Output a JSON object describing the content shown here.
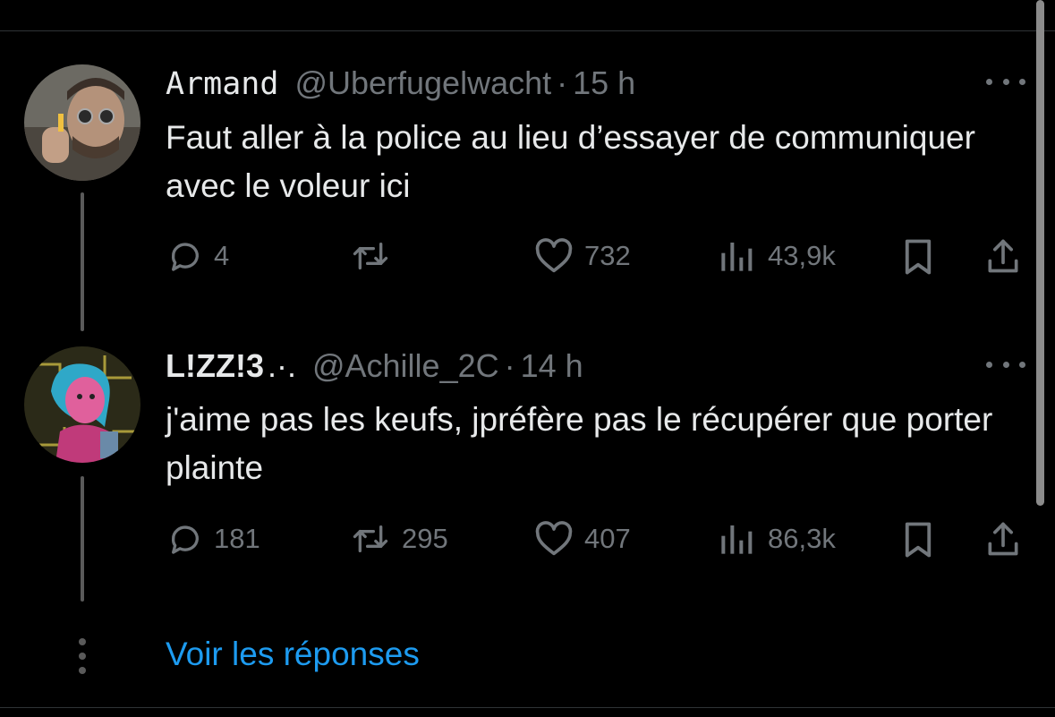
{
  "thread": {
    "tweets": [
      {
        "display_name": "Armand",
        "handle": "@Uberfugelwacht",
        "separator": "·",
        "time": "15 h",
        "text": "Faut aller à la police au lieu d’essayer de communiquer avec le voleur ici",
        "replies": "4",
        "retweets": "",
        "likes": "732",
        "views": "43,9k"
      },
      {
        "display_name": "L!ZZ!3",
        "display_name_suffix": ".·.",
        "handle": "@Achille_2C",
        "separator": "·",
        "time": "14 h",
        "text": "j'aime pas les keufs, jpréfère pas le récupérer que porter plainte",
        "replies": "181",
        "retweets": "295",
        "likes": "407",
        "views": "86,3k"
      }
    ],
    "show_replies": "Voir les réponses"
  },
  "colors": {
    "background": "#000000",
    "text": "#e7e9ea",
    "muted": "#71767b",
    "link": "#1d9bf0",
    "divider": "#2f3336"
  },
  "icons": [
    "reply-icon",
    "retweet-icon",
    "like-icon",
    "views-icon",
    "bookmark-icon",
    "share-icon",
    "more-icon"
  ]
}
